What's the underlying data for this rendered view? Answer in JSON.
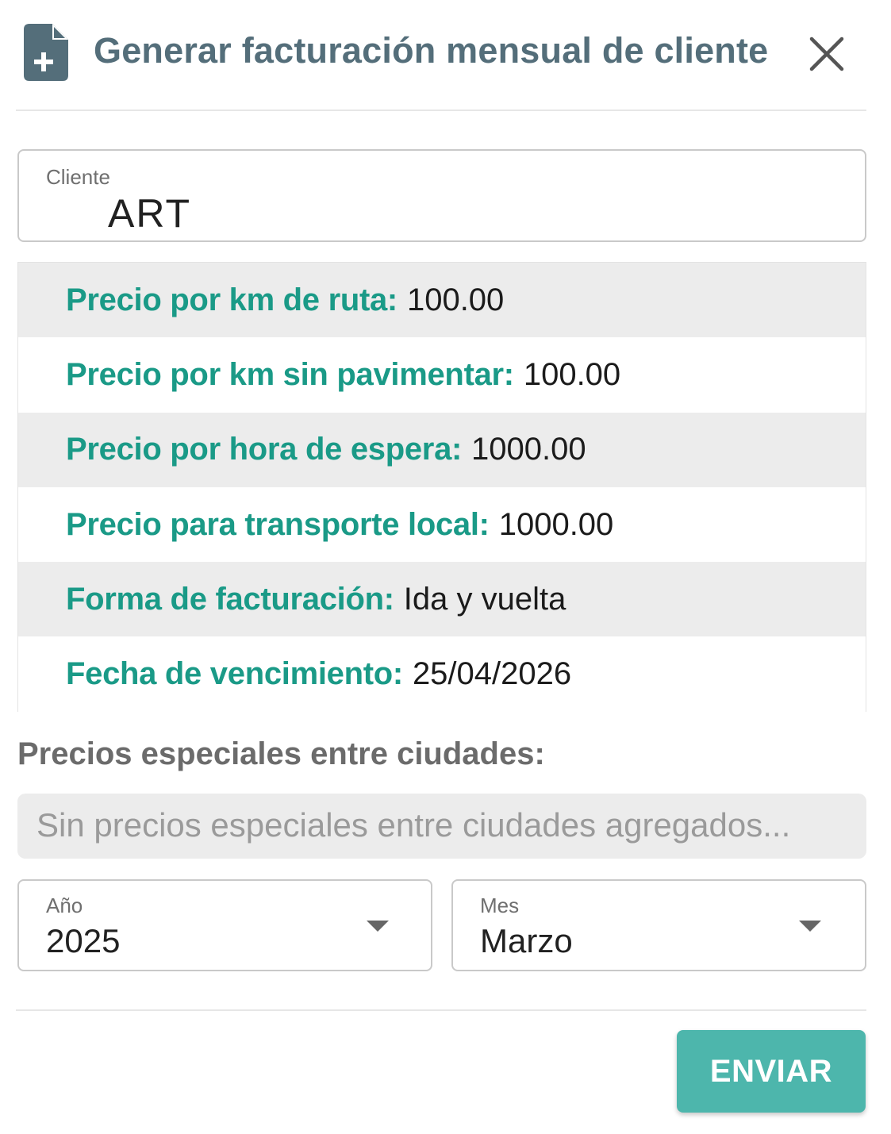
{
  "dialog": {
    "title": "Generar facturación mensual de cliente",
    "header_icon": "file-plus-icon",
    "close_icon": "close-icon"
  },
  "client_field": {
    "label": "Cliente",
    "value": "ART"
  },
  "client_info": [
    {
      "key": "Precio por km de ruta:",
      "value": "100.00"
    },
    {
      "key": "Precio por km sin pavimentar:",
      "value": "100.00"
    },
    {
      "key": "Precio por hora de espera:",
      "value": "1000.00"
    },
    {
      "key": "Precio para transporte local:",
      "value": "1000.00"
    },
    {
      "key": "Forma de facturación:",
      "value": "Ida y vuelta"
    },
    {
      "key": "Fecha de vencimiento:",
      "value": "25/04/2026"
    }
  ],
  "special_prices": {
    "heading": "Precios especiales entre ciudades:",
    "empty_text": "Sin precios especiales entre ciudades agregados..."
  },
  "year_select": {
    "label": "Año",
    "value": "2025"
  },
  "month_select": {
    "label": "Mes",
    "value": "Marzo"
  },
  "submit_button": {
    "label": "ENVIAR"
  },
  "colors": {
    "title": "#546e7a",
    "info_key": "#1a9a87",
    "accent_button": "#4db6ac",
    "row_shaded": "#ececec"
  }
}
